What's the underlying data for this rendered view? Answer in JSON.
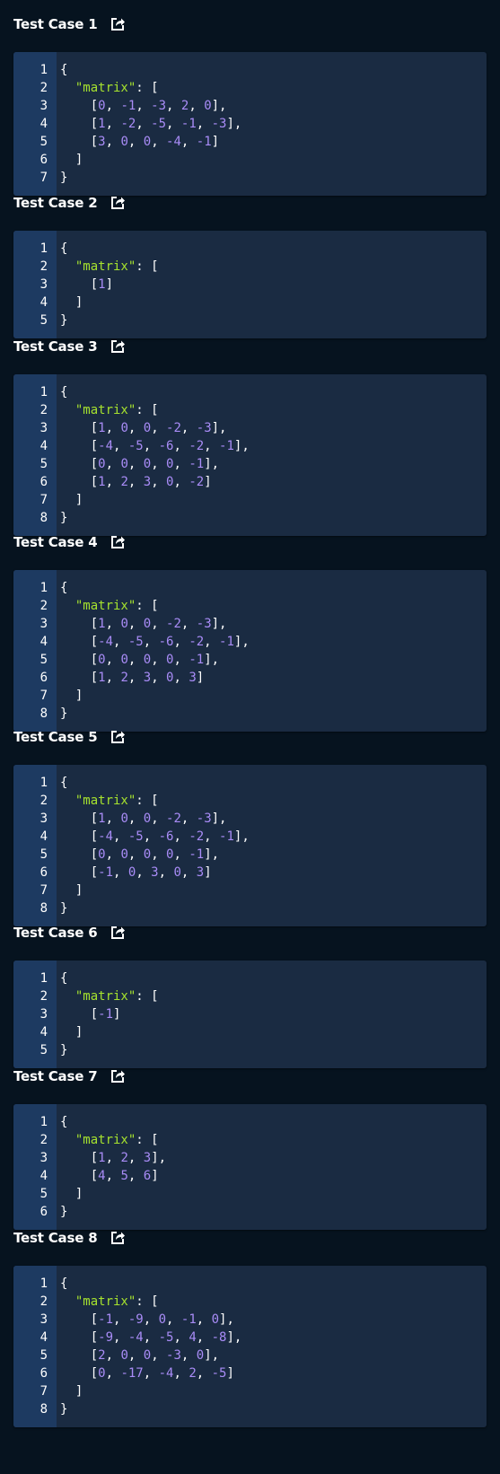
{
  "colors": {
    "background": "#06131f",
    "code_bg": "#1a2b42",
    "gutter_bg": "#1d3a61",
    "key": "#a6e22e",
    "number": "#a98cf7",
    "text": "#ffffff"
  },
  "share_icon": "external-share-icon",
  "test_cases": [
    {
      "title": "Test Case 1",
      "key": "\"matrix\"",
      "line_numbers": [
        "1",
        "2",
        "3",
        "4",
        "5",
        "6",
        "7"
      ],
      "rows": [
        [
          "0",
          "-1",
          "-3",
          "2",
          "0"
        ],
        [
          "1",
          "-2",
          "-5",
          "-1",
          "-3"
        ],
        [
          "3",
          "0",
          "0",
          "-4",
          "-1"
        ]
      ]
    },
    {
      "title": "Test Case 2",
      "key": "\"matrix\"",
      "line_numbers": [
        "1",
        "2",
        "3",
        "4",
        "5"
      ],
      "rows": [
        [
          "1"
        ]
      ]
    },
    {
      "title": "Test Case 3",
      "key": "\"matrix\"",
      "line_numbers": [
        "1",
        "2",
        "3",
        "4",
        "5",
        "6",
        "7",
        "8"
      ],
      "rows": [
        [
          "1",
          "0",
          "0",
          "-2",
          "-3"
        ],
        [
          "-4",
          "-5",
          "-6",
          "-2",
          "-1"
        ],
        [
          "0",
          "0",
          "0",
          "0",
          "-1"
        ],
        [
          "1",
          "2",
          "3",
          "0",
          "-2"
        ]
      ]
    },
    {
      "title": "Test Case 4",
      "key": "\"matrix\"",
      "line_numbers": [
        "1",
        "2",
        "3",
        "4",
        "5",
        "6",
        "7",
        "8"
      ],
      "rows": [
        [
          "1",
          "0",
          "0",
          "-2",
          "-3"
        ],
        [
          "-4",
          "-5",
          "-6",
          "-2",
          "-1"
        ],
        [
          "0",
          "0",
          "0",
          "0",
          "-1"
        ],
        [
          "1",
          "2",
          "3",
          "0",
          "3"
        ]
      ]
    },
    {
      "title": "Test Case 5",
      "key": "\"matrix\"",
      "line_numbers": [
        "1",
        "2",
        "3",
        "4",
        "5",
        "6",
        "7",
        "8"
      ],
      "rows": [
        [
          "1",
          "0",
          "0",
          "-2",
          "-3"
        ],
        [
          "-4",
          "-5",
          "-6",
          "-2",
          "-1"
        ],
        [
          "0",
          "0",
          "0",
          "0",
          "-1"
        ],
        [
          "-1",
          "0",
          "3",
          "0",
          "3"
        ]
      ]
    },
    {
      "title": "Test Case 6",
      "key": "\"matrix\"",
      "line_numbers": [
        "1",
        "2",
        "3",
        "4",
        "5"
      ],
      "rows": [
        [
          "-1"
        ]
      ]
    },
    {
      "title": "Test Case 7",
      "key": "\"matrix\"",
      "line_numbers": [
        "1",
        "2",
        "3",
        "4",
        "5",
        "6"
      ],
      "rows": [
        [
          "1",
          "2",
          "3"
        ],
        [
          "4",
          "5",
          "6"
        ]
      ]
    },
    {
      "title": "Test Case 8",
      "key": "\"matrix\"",
      "line_numbers": [
        "1",
        "2",
        "3",
        "4",
        "5",
        "6",
        "7",
        "8"
      ],
      "rows": [
        [
          "-1",
          "-9",
          "0",
          "-1",
          "0"
        ],
        [
          "-9",
          "-4",
          "-5",
          "4",
          "-8"
        ],
        [
          "2",
          "0",
          "0",
          "-3",
          "0"
        ],
        [
          "0",
          "-17",
          "-4",
          "2",
          "-5"
        ]
      ]
    }
  ]
}
